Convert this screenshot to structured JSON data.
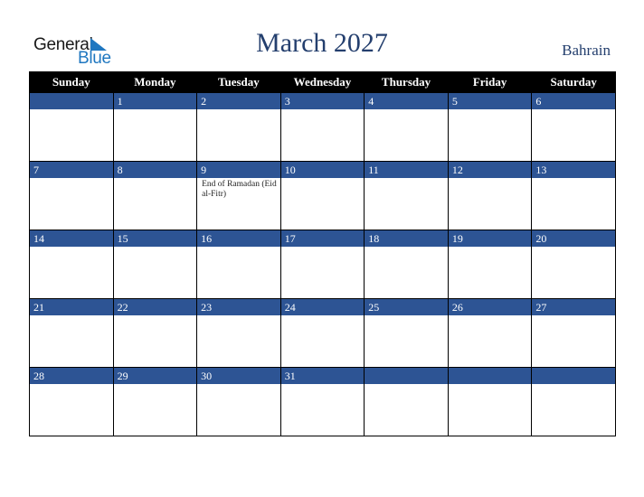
{
  "logo": {
    "word1": "General",
    "word2": "Blue"
  },
  "header": {
    "title": "March 2027",
    "country": "Bahrain"
  },
  "colors": {
    "header_bg": "#000000",
    "day_bar": "#2d5494",
    "title": "#243f6e",
    "logo_blue": "#1f77c0"
  },
  "weekdays": [
    "Sunday",
    "Monday",
    "Tuesday",
    "Wednesday",
    "Thursday",
    "Friday",
    "Saturday"
  ],
  "weeks": [
    [
      {
        "day": ""
      },
      {
        "day": "1"
      },
      {
        "day": "2"
      },
      {
        "day": "3"
      },
      {
        "day": "4"
      },
      {
        "day": "5"
      },
      {
        "day": "6"
      }
    ],
    [
      {
        "day": "7"
      },
      {
        "day": "8"
      },
      {
        "day": "9",
        "event": "End of Ramadan (Eid al-Fitr)"
      },
      {
        "day": "10"
      },
      {
        "day": "11"
      },
      {
        "day": "12"
      },
      {
        "day": "13"
      }
    ],
    [
      {
        "day": "14"
      },
      {
        "day": "15"
      },
      {
        "day": "16"
      },
      {
        "day": "17"
      },
      {
        "day": "18"
      },
      {
        "day": "19"
      },
      {
        "day": "20"
      }
    ],
    [
      {
        "day": "21"
      },
      {
        "day": "22"
      },
      {
        "day": "23"
      },
      {
        "day": "24"
      },
      {
        "day": "25"
      },
      {
        "day": "26"
      },
      {
        "day": "27"
      }
    ],
    [
      {
        "day": "28"
      },
      {
        "day": "29"
      },
      {
        "day": "30"
      },
      {
        "day": "31"
      },
      {
        "day": ""
      },
      {
        "day": ""
      },
      {
        "day": ""
      }
    ]
  ]
}
